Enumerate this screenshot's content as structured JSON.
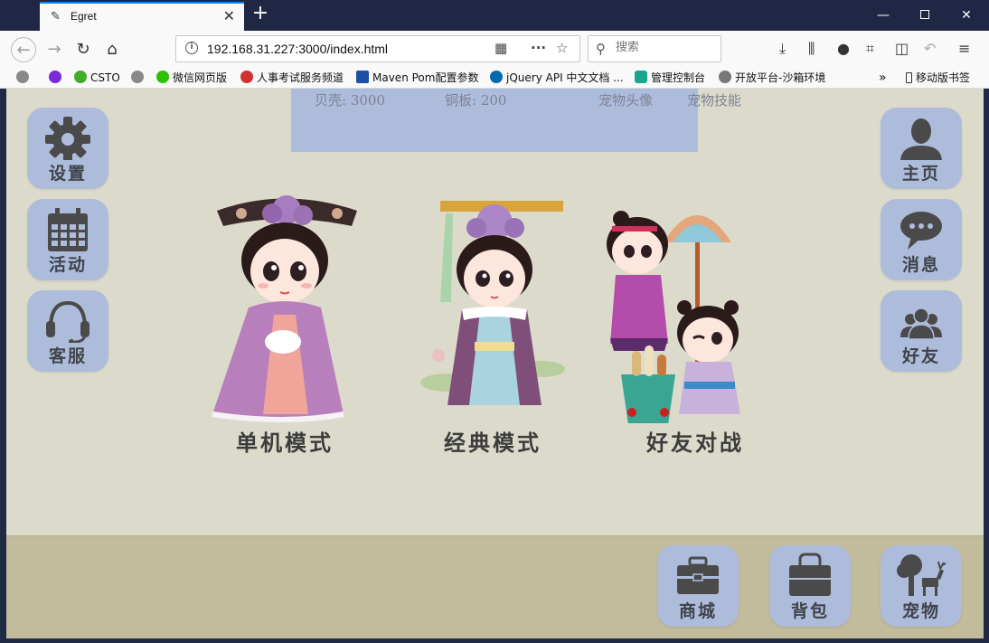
{
  "browser": {
    "tab_title": "Egret",
    "url": "192.168.31.227:3000/index.html",
    "search_placeholder": "搜索",
    "bookmarks": [
      {
        "label": "CSTO",
        "color": "#3fae2a"
      },
      {
        "label": "微信网页版",
        "color": "#2dc100"
      },
      {
        "label": "人事考试服务频道",
        "color": "#d0312d"
      },
      {
        "label": "Maven Pom配置参数",
        "color": "#1f4fa3"
      },
      {
        "label": "jQuery API 中文文档 ...",
        "color": "#0769ad"
      },
      {
        "label": "管理控制台",
        "color": "#1aa68c"
      },
      {
        "label": "开放平台-沙箱环境",
        "color": "#777777"
      }
    ],
    "mobile_bookmarks": "移动版书签"
  },
  "game": {
    "stats": {
      "shell": "贝壳: 3000",
      "copper": "铜板: 200",
      "pet_avatar": "宠物头像",
      "pet_skill": "宠物技能"
    },
    "left_buttons": [
      {
        "label": "设置",
        "icon": "gear-icon"
      },
      {
        "label": "活动",
        "icon": "calendar-icon"
      },
      {
        "label": "客服",
        "icon": "headset-icon"
      }
    ],
    "right_buttons": [
      {
        "label": "主页",
        "icon": "user-icon"
      },
      {
        "label": "消息",
        "icon": "chat-bubble-icon"
      },
      {
        "label": "好友",
        "icon": "friends-icon"
      }
    ],
    "modes": [
      {
        "label": "单机模式"
      },
      {
        "label": "经典模式"
      },
      {
        "label": "好友对战"
      }
    ],
    "bottom_buttons": [
      {
        "label": "商城",
        "icon": "toolbox-icon"
      },
      {
        "label": "背包",
        "icon": "bag-icon"
      },
      {
        "label": "宠物",
        "icon": "tree-deer-icon"
      }
    ],
    "colors": {
      "background": "#dcdbcb",
      "bottom_bar": "#c2bc9c",
      "button": "#aebcdc",
      "button_text": "#3f434a"
    }
  }
}
